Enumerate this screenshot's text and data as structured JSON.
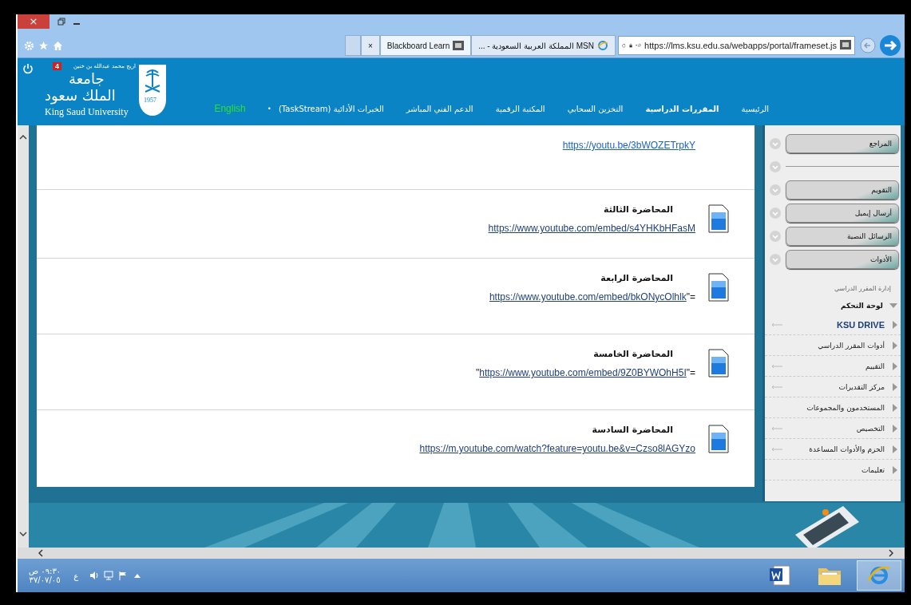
{
  "browser": {
    "tab_close": "×",
    "tabs": [
      {
        "label": "MSN المملكة العربية السعودية - ...",
        "kind": "ie",
        "selected": false
      },
      {
        "label": "Blackboard Learn",
        "kind": "bb",
        "selected": true
      }
    ],
    "address": "https://lms.ksu.edu.sa/webapps/portal/frameset.js"
  },
  "header": {
    "user": "اريج محمد عبدالله بن خنين",
    "badge": "4",
    "logo_ar_1": "جامعة",
    "logo_ar_2": "الملك سعود",
    "logo_en": "King Saud University",
    "emblem_year": "1957",
    "nav": [
      {
        "label": "الرئيسية",
        "selected": false
      },
      {
        "label": "المقررات الدراسية",
        "selected": true
      },
      {
        "label": "التخزين السحابي",
        "selected": false
      },
      {
        "label": "المكتبة الرقمية",
        "selected": false
      },
      {
        "label": "الدعم الفني المباشر",
        "selected": false
      },
      {
        "label": "الخبرات الأدائية (TaskStream)",
        "selected": false
      }
    ],
    "separator": "•",
    "language": "English"
  },
  "content": {
    "items": [
      {
        "link": "https://youtu.be/3bWOZETrpkY",
        "visited": false
      },
      {
        "title": "المحاضرة الثالثة",
        "link": "https://www.youtube.com/embed/s4YHKbHFasM",
        "visited": true
      },
      {
        "title": "المحاضرة الرابعة",
        "link": "https://www.youtube.com/embed/bkONycOlhlk",
        "suffix": "\"=",
        "visited": true
      },
      {
        "title": "المحاضرة الخامسة",
        "prefix": "\"",
        "link": "https://www.youtube.com/embed/9Z0BYWOhH5I",
        "suffix": "\"=",
        "visited": true
      },
      {
        "title": "المحاضرة السادسة",
        "link": "https://m.youtube.com/watch?feature=youtu.be&v=Czso8lAGYzo",
        "visited": true
      }
    ]
  },
  "sidebar": {
    "buttons": [
      {
        "kind": "button",
        "label": "المراجع"
      },
      {
        "kind": "divider"
      },
      {
        "kind": "button",
        "label": "التقويم"
      },
      {
        "kind": "button",
        "label": "أرسال إيميل"
      },
      {
        "kind": "button",
        "label": "الرسائل النصية"
      },
      {
        "kind": "button",
        "label": "الأدوات"
      }
    ],
    "management": {
      "title": "إدارة المقرر الدراسي",
      "panel": {
        "label": "لوحة التحكم",
        "expanded": true
      },
      "items": [
        {
          "label": "KSU DRIVE",
          "kind": "drive",
          "arrow": true
        },
        {
          "label": "أدوات المقرر الدراسي",
          "kind": "tool",
          "arrow": false
        },
        {
          "label": "التقييم",
          "kind": "tool",
          "arrow": true
        },
        {
          "label": "مركز التقديرات",
          "kind": "tool",
          "arrow": true
        },
        {
          "label": "المستخدمون والمجموعات",
          "kind": "tool",
          "arrow": false
        },
        {
          "label": "التخصيص",
          "kind": "tool",
          "arrow": true
        },
        {
          "label": "الحزم والأدوات المساعدة",
          "kind": "tool",
          "arrow": true
        },
        {
          "label": "تعليمات",
          "kind": "tool",
          "arrow": false
        }
      ]
    }
  },
  "taskbar": {
    "time": "٠٩:٣٠ ص",
    "date": "٣٧/٠٧/٠٥",
    "language": "ع",
    "apps": [
      {
        "kind": "word",
        "selected": false
      },
      {
        "kind": "folder",
        "selected": false
      },
      {
        "kind": "ie",
        "selected": true
      }
    ]
  }
}
